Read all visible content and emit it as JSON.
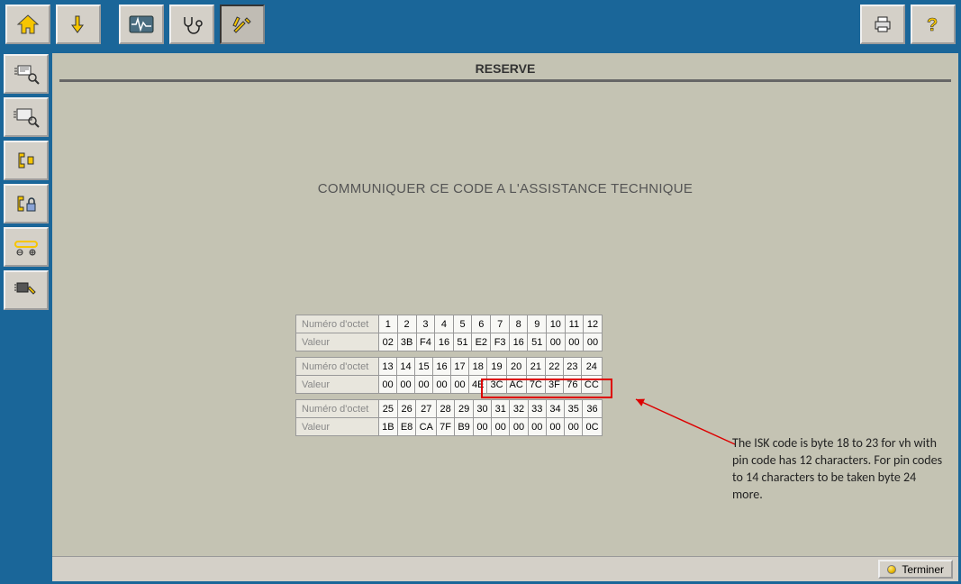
{
  "header": {
    "title": "RESERVE"
  },
  "subtitle": "COMMUNIQUER CE CODE A L'ASSISTANCE TECHNIQUE",
  "tables": {
    "row_label_num": "Numéro d'octet",
    "row_label_val": "Valeur",
    "block1": {
      "nums": [
        "1",
        "2",
        "3",
        "4",
        "5",
        "6",
        "7",
        "8",
        "9",
        "10",
        "11",
        "12"
      ],
      "vals": [
        "02",
        "3B",
        "F4",
        "16",
        "51",
        "E2",
        "F3",
        "16",
        "51",
        "00",
        "00",
        "00"
      ]
    },
    "block2": {
      "nums": [
        "13",
        "14",
        "15",
        "16",
        "17",
        "18",
        "19",
        "20",
        "21",
        "22",
        "23",
        "24"
      ],
      "vals": [
        "00",
        "00",
        "00",
        "00",
        "00",
        "4E",
        "3C",
        "AC",
        "7C",
        "3F",
        "76",
        "CC"
      ]
    },
    "block3": {
      "nums": [
        "25",
        "26",
        "27",
        "28",
        "29",
        "30",
        "31",
        "32",
        "33",
        "34",
        "35",
        "36"
      ],
      "vals": [
        "1B",
        "E8",
        "CA",
        "7F",
        "B9",
        "00",
        "00",
        "00",
        "00",
        "00",
        "00",
        "0C"
      ]
    }
  },
  "annotation": "The ISK code is byte 18 to 23 for vh with pin code has 12 characters. For pin codes to 14 characters to be taken byte 24 more.",
  "footer": {
    "finish": "Terminer"
  }
}
